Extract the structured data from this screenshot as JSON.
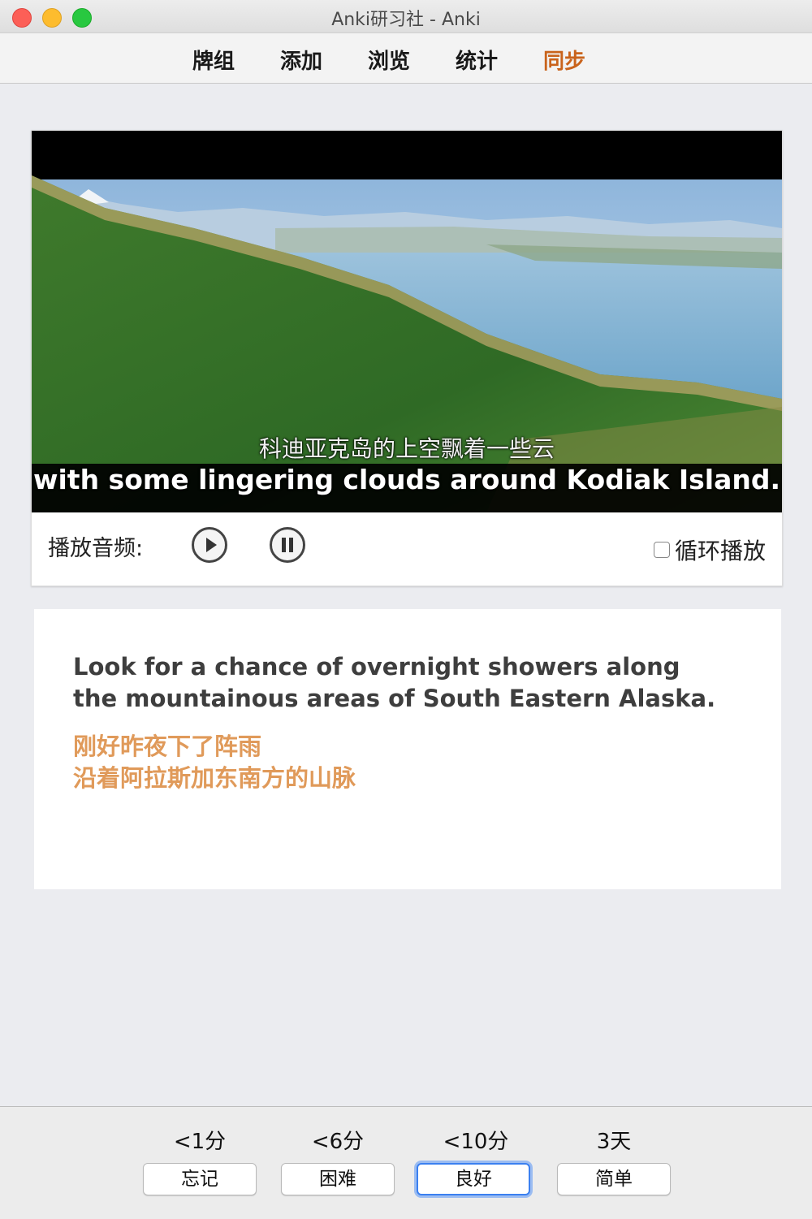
{
  "window": {
    "title": "Anki研习社 - Anki"
  },
  "toolbar": {
    "items": [
      {
        "label": "牌组"
      },
      {
        "label": "添加"
      },
      {
        "label": "浏览"
      },
      {
        "label": "统计"
      },
      {
        "label": "同步",
        "active": true
      }
    ],
    "active_color": "#c9631b"
  },
  "video": {
    "subtitle_zh": "科迪亚克岛的上空飘着一些云",
    "subtitle_en": "with some lingering clouds around Kodiak Island.",
    "controls": {
      "audio_label": "播放音频:",
      "play_icon": "play-icon",
      "pause_icon": "pause-icon",
      "loop_label": "循环播放",
      "loop_checked": false
    }
  },
  "card": {
    "english": "Look for a chance of overnight showers along the mountainous areas of South Eastern Alaska.",
    "chinese_line1": "刚好昨夜下了阵雨",
    "chinese_line2": "沿着阿拉斯加东南方的山脉",
    "chinese_color": "#e09a5a"
  },
  "answers": [
    {
      "interval": "<1分",
      "label": "忘记"
    },
    {
      "interval": "<6分",
      "label": "困难"
    },
    {
      "interval": "<10分",
      "label": "良好",
      "focused": true
    },
    {
      "interval": "3天",
      "label": "简单"
    }
  ]
}
